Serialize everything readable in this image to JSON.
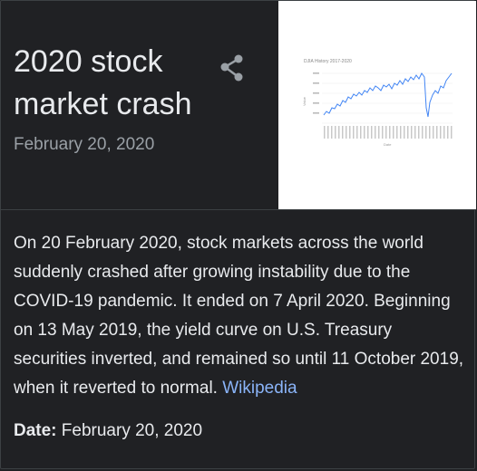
{
  "panel": {
    "title": "2020 stock market crash",
    "subtitle": "February 20, 2020",
    "share_icon": "share-icon"
  },
  "thumbnail": {
    "chart_title": "DJIA History 2017-2020",
    "axis_x_label": "Date",
    "axis_y_label": "Value",
    "line_color": "#4285f4"
  },
  "description": {
    "text": "On 20 February 2020, stock markets across the world suddenly crashed after growing instability due to the COVID-19 pandemic. It ended on 7 April 2020. Beginning on 13 May 2019, the yield curve on U.S. Treasury securities inverted, and remained so until 11 October 2019, when it reverted to normal.",
    "source_link": "Wikipedia"
  },
  "facts": [
    {
      "label": "Date:",
      "value": "February 20, 2020"
    }
  ],
  "colors": {
    "background": "#202124",
    "text": "#e8eaed",
    "secondary_text": "#9aa0a6",
    "link": "#8ab4f8",
    "border": "#3c4043"
  }
}
